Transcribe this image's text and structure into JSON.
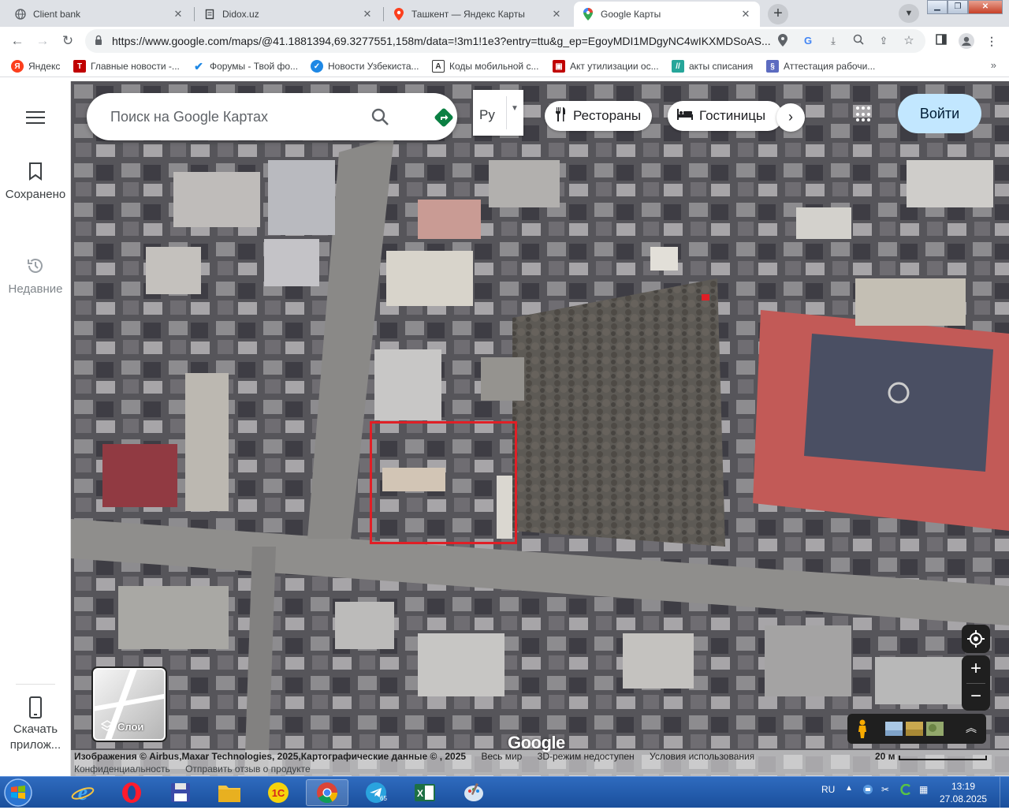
{
  "tabs": [
    {
      "title": "Client bank",
      "icon": "globe-icon",
      "close": "✕"
    },
    {
      "title": "Didox.uz",
      "icon": "document-icon",
      "close": "✕"
    },
    {
      "title": "Ташкент — Яндекс Карты",
      "icon": "yandex-maps-pin-icon",
      "close": "✕"
    },
    {
      "title": "Google Карты",
      "icon": "google-maps-pin-icon",
      "close": "✕"
    }
  ],
  "toolbar": {
    "url": "https://www.google.com/maps/@41.1881394,69.3277551,158m/data=!3m1!1e3?entry=ttu&g_ep=EgoyMDI1MDgyNC4wIKXMDSoAS..."
  },
  "bookmarks": [
    {
      "label": "Яндекс",
      "icon": "yandex-icon",
      "color": "#fc3f1d"
    },
    {
      "label": "Главные новости -...",
      "icon": "news-icon",
      "color": "#c00000"
    },
    {
      "label": "Форумы - Твой фо...",
      "icon": "forum-icon",
      "color": "#1e88e5"
    },
    {
      "label": "Новости Узбекиста...",
      "icon": "verified-icon",
      "color": "#1e88e5"
    },
    {
      "label": "Коды мобильной с...",
      "icon": "warning-icon",
      "color": "#333333"
    },
    {
      "label": "Акт утилизации ос...",
      "icon": "pdf-icon",
      "color": "#c00000"
    },
    {
      "label": "акты списания",
      "icon": "doc-icon",
      "color": "#26a69a"
    },
    {
      "label": "Аттестация рабочи...",
      "icon": "page-icon",
      "color": "#5c6bc0"
    }
  ],
  "rail": {
    "saved": "Сохранено",
    "recent": "Недавние",
    "download": "Скачать прилож..."
  },
  "maps": {
    "search_placeholder": "Поиск на Google Картах",
    "language": "Ру",
    "chips": [
      "Рестораны",
      "Гостиницы"
    ],
    "signin": "Войти",
    "layers": "Слои",
    "google": "Google",
    "attribution": "Изображения © Airbus,Maxar Technologies, 2025,Картографические данные © , 2025",
    "world": "Весь мир",
    "no3d": "3D-режим недоступен",
    "terms": "Условия использования",
    "privacy": "Конфиденциальность",
    "feedback": "Отправить отзыв о продукте",
    "scale": "20 м"
  },
  "taskbar": {
    "lang": "RU",
    "time": "13:19",
    "date": "27.08.2025",
    "telegram_badge": "65",
    "apps": [
      "internet-explorer-icon",
      "opera-icon",
      "floppy-save-icon",
      "file-explorer-icon",
      "1c-icon",
      "chrome-icon",
      "telegram-icon",
      "excel-icon",
      "paint-icon"
    ]
  }
}
